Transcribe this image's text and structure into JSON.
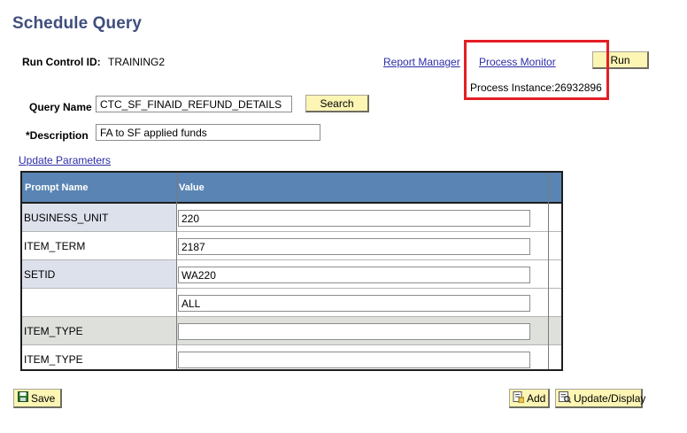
{
  "page": {
    "title": "Schedule Query"
  },
  "run_control": {
    "label": "Run Control ID:",
    "value": "TRAINING2"
  },
  "links": {
    "report_manager": "Report Manager",
    "process_monitor": "Process Monitor",
    "update_parameters": "Update Parameters"
  },
  "run_button": "Run",
  "process_instance": "Process Instance:26932896",
  "query_name": {
    "label": "Query Name",
    "value": "CTC_SF_FINAID_REFUND_DETAILS"
  },
  "search_button": "Search",
  "description": {
    "label": "*Description",
    "value": "FA to SF applied funds"
  },
  "grid": {
    "headers": [
      "Prompt Name",
      "Value"
    ],
    "rows": [
      {
        "prompt": "BUSINESS_UNIT",
        "value": "220"
      },
      {
        "prompt": "ITEM_TERM",
        "value": "2187"
      },
      {
        "prompt": "SETID",
        "value": "WA220"
      },
      {
        "prompt": "",
        "value": "ALL"
      },
      {
        "prompt": "ITEM_TYPE",
        "value": ""
      },
      {
        "prompt": "ITEM_TYPE",
        "value": ""
      }
    ]
  },
  "footer": {
    "save": "Save",
    "add": "Add",
    "update_display": "Update/Display"
  },
  "icons": {
    "save": "save-icon",
    "add": "add-icon",
    "update_display": "update-display-icon"
  },
  "colors": {
    "title": "#3f4e7d",
    "grid_header": "#5a84b3",
    "button": "#fcf5b4",
    "highlight": "#e41e25",
    "link": "#2d2da8"
  }
}
